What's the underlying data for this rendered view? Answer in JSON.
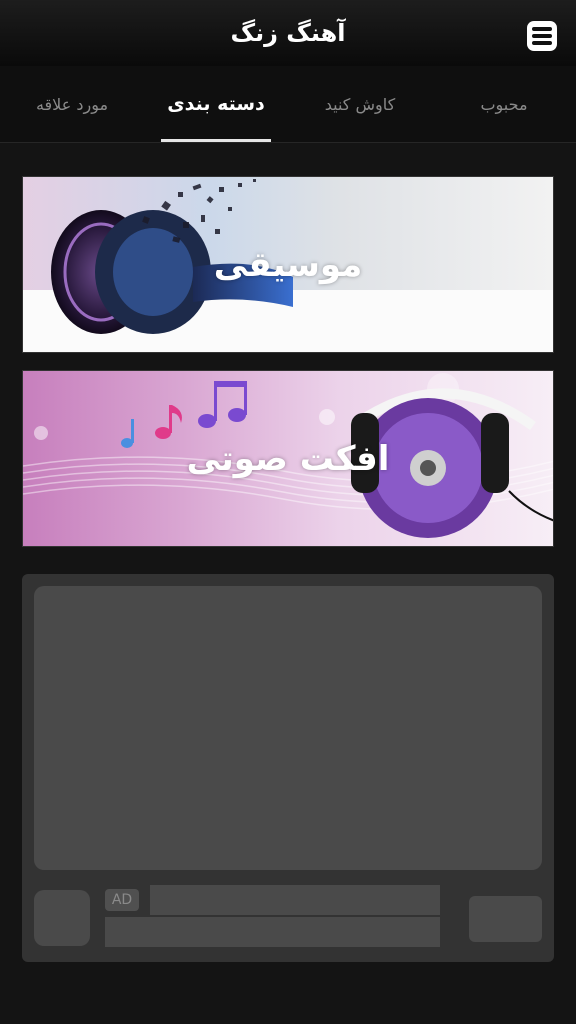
{
  "header": {
    "title": "آهنگ زنگ",
    "menu_icon": "menu-icon"
  },
  "tabs": [
    {
      "label": "محبوب",
      "active": false
    },
    {
      "label": "کاوش کنید",
      "active": false
    },
    {
      "label": "دسته بندی",
      "active": true
    },
    {
      "label": "مورد علاقه",
      "active": false
    }
  ],
  "categories": [
    {
      "label": "موسیقی",
      "image": "headphones-music-image"
    },
    {
      "label": "افکت صوتی",
      "image": "headphones-disc-music-notes-image"
    }
  ],
  "ad": {
    "badge": "AD"
  },
  "colors": {
    "background": "#141414",
    "tab_active": "#ffffff",
    "tab_inactive": "#8a8a8a",
    "ad_placeholder": "#4a4a4a"
  }
}
